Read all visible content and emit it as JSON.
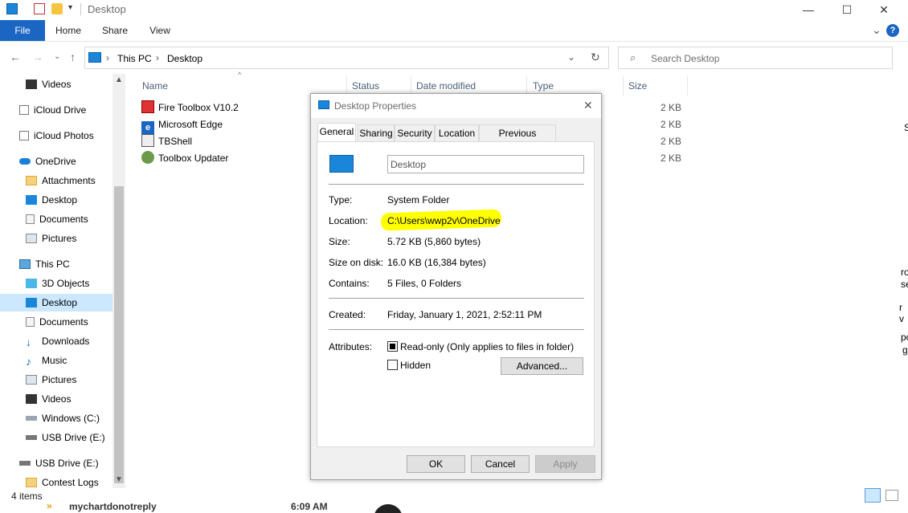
{
  "window": {
    "title": "Desktop",
    "ribbon_tabs": [
      "File",
      "Home",
      "Share",
      "View"
    ],
    "minimize": "—",
    "maximize": "☐",
    "close": "✕",
    "collapse_ribbon": "⌄",
    "help": "?"
  },
  "address": {
    "breadcrumb": [
      "This PC",
      "Desktop"
    ],
    "separator": "›",
    "search_placeholder": "Search Desktop"
  },
  "nav": {
    "items": [
      {
        "label": "Videos",
        "icon": "videos-icon"
      },
      {
        "label": "iCloud Drive",
        "icon": "icloud-drive-icon"
      },
      {
        "label": "iCloud Photos",
        "icon": "icloud-photos-icon"
      },
      {
        "label": "OneDrive",
        "icon": "onedrive-icon"
      },
      {
        "label": "Attachments",
        "icon": "folder-icon"
      },
      {
        "label": "Desktop",
        "icon": "desktop-icon"
      },
      {
        "label": "Documents",
        "icon": "documents-icon"
      },
      {
        "label": "Pictures",
        "icon": "pictures-icon"
      },
      {
        "label": "This PC",
        "icon": "this-pc-icon"
      },
      {
        "label": "3D Objects",
        "icon": "3d-objects-icon"
      },
      {
        "label": "Desktop",
        "icon": "desktop-icon"
      },
      {
        "label": "Documents",
        "icon": "documents-icon"
      },
      {
        "label": "Downloads",
        "icon": "downloads-icon"
      },
      {
        "label": "Music",
        "icon": "music-icon"
      },
      {
        "label": "Pictures",
        "icon": "pictures-icon"
      },
      {
        "label": "Videos",
        "icon": "videos-icon"
      },
      {
        "label": "Windows (C:)",
        "icon": "windows-drive-icon"
      },
      {
        "label": "USB Drive (E:)",
        "icon": "usb-drive-icon"
      },
      {
        "label": "USB Drive (E:)",
        "icon": "usb-drive-icon"
      },
      {
        "label": "Contest Logs",
        "icon": "folder-icon"
      }
    ]
  },
  "columns": {
    "name": "Name",
    "status": "Status",
    "date_modified": "Date modified",
    "type": "Type",
    "size": "Size"
  },
  "files": [
    {
      "name": "Fire Toolbox V10.2",
      "size": "2 KB"
    },
    {
      "name": "Microsoft Edge",
      "size": "2 KB"
    },
    {
      "name": "TBShell",
      "size": "2 KB"
    },
    {
      "name": "Toolbox Updater",
      "size": "2 KB"
    }
  ],
  "status": {
    "item_count": "4 items"
  },
  "taskbar_strip": {
    "text": "mychartdonotreply",
    "time": "6:09 AM"
  },
  "right_edge_fragments": [
    "S",
    "ro",
    "se",
    "r v",
    "po",
    "g"
  ],
  "dialog": {
    "title": "Desktop Properties",
    "tabs": [
      "General",
      "Sharing",
      "Security",
      "Location",
      "Previous Versions"
    ],
    "name_value": "Desktop",
    "type_label": "Type:",
    "type_value": "System Folder",
    "location_label": "Location:",
    "location_value": "C:\\Users\\wwp2v\\OneDrive",
    "size_label": "Size:",
    "size_value": "5.72 KB (5,860 bytes)",
    "size_on_disk_label": "Size on disk:",
    "size_on_disk_value": "16.0 KB (16,384 bytes)",
    "contains_label": "Contains:",
    "contains_value": "5 Files, 0 Folders",
    "created_label": "Created:",
    "created_value": "Friday, January 1, 2021, 2:52:11 PM",
    "attributes_label": "Attributes:",
    "readonly_label": "Read-only (Only applies to files in folder)",
    "hidden_label": "Hidden",
    "advanced_button": "Advanced...",
    "ok_button": "OK",
    "cancel_button": "Cancel",
    "apply_button": "Apply",
    "highlight_color": "#ffff00"
  }
}
